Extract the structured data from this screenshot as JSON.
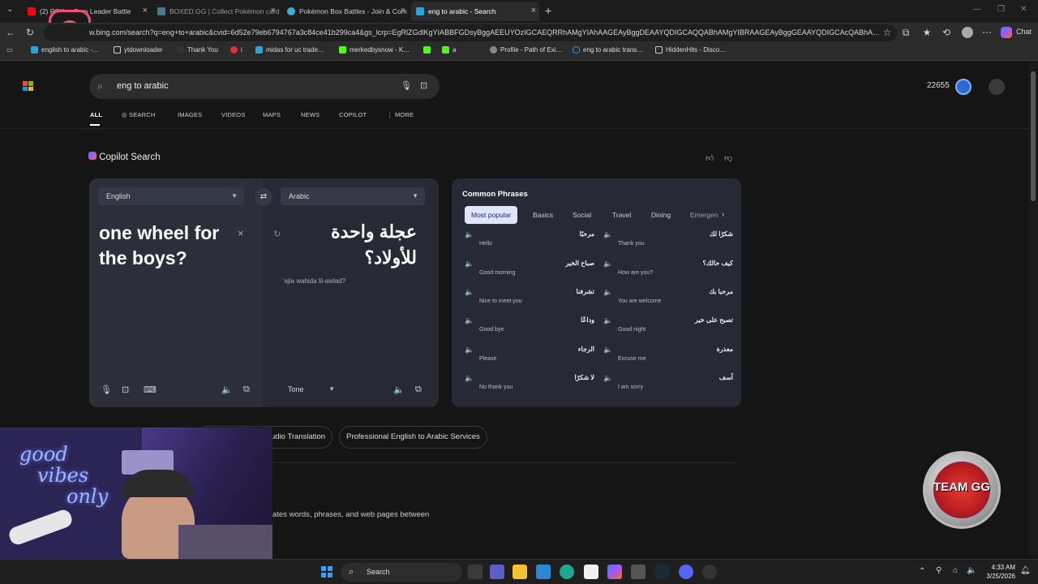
{
  "tabs": [
    {
      "label": "(2) POK… Gym Leader Battle",
      "icon": "youtube-icon",
      "color": "#ff0000"
    },
    {
      "label": "BOXED.GG | Collect Pokémon card",
      "icon": "boxed-icon",
      "color": "#4a7a8a"
    },
    {
      "label": "Pokémon Box Battles - Join & Com",
      "icon": "pokemon-icon",
      "color": "#3ab0d9"
    },
    {
      "label": "eng to arabic - Search",
      "icon": "bing-icon",
      "color": "#2aa3d9"
    }
  ],
  "address": {
    "url": "https://www.bing.com/search?q=eng+to+arabic&cvid=6d52e79eb6794767a3c84ce41b299ca4&gs_lcrp=EgRlZGdlKgYIABBFGDsyBggAEEUYOzIGCAEQRRhAMgYIAhAAGEAyBggDEAAYQDIGCAQQABhAMgYIBRAAGEAyBggGEAAYQDIGCAcQABhA…",
    "shown": "w.bing.com/search?q=eng+to+arabic&cvid=6d52e79eb6794767a3c84ce41b299ca4&gs_lcrp=EgRlZGdlKgYIABBFGDsyBggAEEUYOzIGCAEQRRhAMgYIAhAAGEAyBggDEAAYQDIGCAQQABhAMgYIBRAAGEAyBggGEAAYQDIGCAcQABhA…",
    "copilot_label": "Chat"
  },
  "bookmarks": [
    {
      "label": "english to arabic -…",
      "color": "#2aa3d9"
    },
    {
      "label": "ytdownloader",
      "color": "#cccccc"
    },
    {
      "label": "Thank You",
      "color": "#333333"
    },
    {
      "label": "i",
      "color": "#d33"
    },
    {
      "label": "midas for uc trade…",
      "color": "#2aa3d9"
    },
    {
      "label": "merkedbysnow - K…",
      "color": "#53fc18"
    },
    {
      "label": "",
      "color": "#53fc18"
    },
    {
      "label": "a",
      "color": "#53fc18"
    },
    {
      "label": "Profile - Path of Exi…",
      "color": "#888"
    },
    {
      "label": "eng to arabic trans…",
      "color": "#2aa3d9"
    },
    {
      "label": "HiddenHits - Disco…",
      "color": "#ccc"
    }
  ],
  "search": {
    "query": "eng to arabic",
    "points": "22655"
  },
  "nav_tabs": [
    "ALL",
    "SEARCH",
    "IMAGES",
    "VIDEOS",
    "MAPS",
    "NEWS",
    "COPILOT",
    "MORE"
  ],
  "copilot_title": "Copilot Search",
  "translator": {
    "source_lang": "English",
    "target_lang": "Arabic",
    "source_text": "one wheel for the boys?",
    "target_text": "عجلة واحدة للأولاد؟",
    "transliteration": "'ajla wahida lil-awlad?",
    "tone_label": "Tone"
  },
  "phrases": {
    "title": "Common Phrases",
    "tabs": [
      "Most popular",
      "Basics",
      "Social",
      "Travel",
      "Dining",
      "Emergen"
    ],
    "items": [
      {
        "ar": "مرحبًا",
        "en": "Hello"
      },
      {
        "ar": "شكرًا لك",
        "en": "Thank you"
      },
      {
        "ar": "صباح الخير",
        "en": "Good morning"
      },
      {
        "ar": "كيف حالك؟",
        "en": "How are you?"
      },
      {
        "ar": "تشرفنا",
        "en": "Nice to meet you"
      },
      {
        "ar": "مرحبا بك",
        "en": "You are welcome"
      },
      {
        "ar": "وداعًا",
        "en": "Good bye"
      },
      {
        "ar": "تصبح على خير",
        "en": "Good night"
      },
      {
        "ar": "الرجاء",
        "en": "Please"
      },
      {
        "ar": "معذرة",
        "en": "Excuse me"
      },
      {
        "ar": "لا شكرًا",
        "en": "No thank you"
      },
      {
        "ar": "آسف",
        "en": "I am sorry"
      }
    ]
  },
  "chips": [
    "udio Translation",
    "Professional English to Arabic Services"
  ],
  "snippet": "ates words, phrases, and web pages between",
  "webcam_neon": {
    "line1": "good",
    "line2": "vibes",
    "line3": "only"
  },
  "badge_text": "TEAM GG",
  "taskbar": {
    "search_label": "Search",
    "time": "4:33 AM",
    "date": "3/25/2026"
  }
}
